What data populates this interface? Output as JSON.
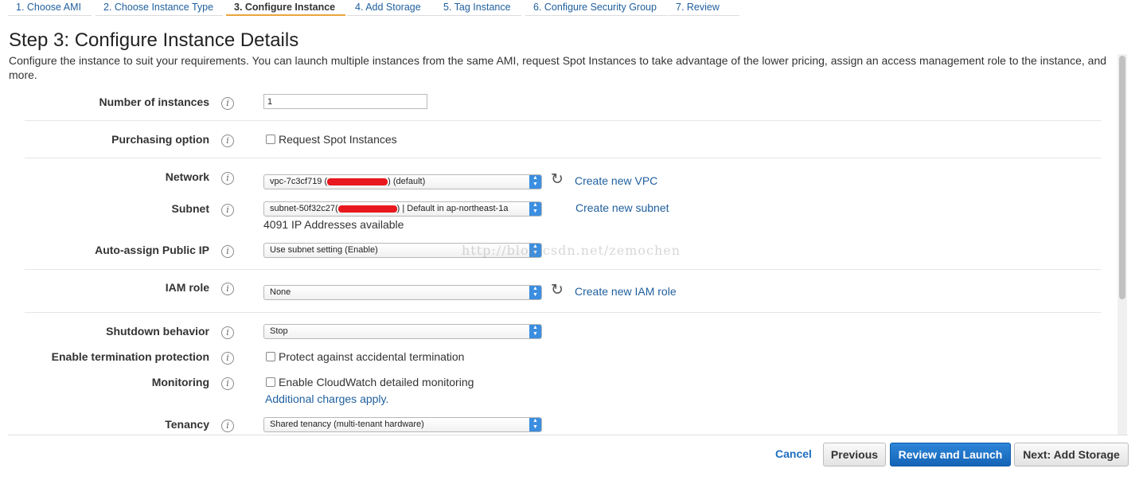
{
  "tabs": [
    {
      "label": "1. Choose AMI"
    },
    {
      "label": "2. Choose Instance Type"
    },
    {
      "label": "3. Configure Instance"
    },
    {
      "label": "4. Add Storage"
    },
    {
      "label": "5. Tag Instance"
    },
    {
      "label": "6. Configure Security Group"
    },
    {
      "label": "7. Review"
    }
  ],
  "page": {
    "title": "Step 3: Configure Instance Details",
    "description": "Configure the instance to suit your requirements. You can launch multiple instances from the same AMI, request Spot Instances to take advantage of the lower pricing, assign an access management role to the instance, and more."
  },
  "info_glyph": "i",
  "form": {
    "number_of_instances": {
      "label": "Number of instances",
      "value": "1"
    },
    "purchasing_option": {
      "label": "Purchasing option",
      "checkbox_label": "Request Spot Instances"
    },
    "network": {
      "label": "Network",
      "value_prefix": "vpc-7c3cf719 (",
      "value_suffix": ") (default)",
      "link": "Create new VPC"
    },
    "subnet": {
      "label": "Subnet",
      "value_prefix": "subnet-50f32c27(",
      "value_suffix": ") | Default in ap-northeast-1a",
      "link": "Create new subnet",
      "note": "4091 IP Addresses available"
    },
    "public_ip": {
      "label": "Auto-assign Public IP",
      "value": "Use subnet setting (Enable)"
    },
    "iam_role": {
      "label": "IAM role",
      "value": "None",
      "link": "Create new IAM role"
    },
    "shutdown": {
      "label": "Shutdown behavior",
      "value": "Stop"
    },
    "termination": {
      "label": "Enable termination protection",
      "checkbox_label": "Protect against accidental termination"
    },
    "monitoring": {
      "label": "Monitoring",
      "checkbox_label": "Enable CloudWatch detailed monitoring",
      "link": "Additional charges apply."
    },
    "tenancy": {
      "label": "Tenancy",
      "value": "Shared tenancy (multi-tenant hardware)"
    }
  },
  "watermark": "http://blog.csdn.net/zemochen",
  "footer": {
    "cancel": "Cancel",
    "previous": "Previous",
    "review_launch": "Review and Launch",
    "next": "Next: Add Storage"
  },
  "icons": {
    "refresh": "refresh-icon",
    "info": "info-icon",
    "select_arrow": "chevron-updown-icon"
  },
  "colors": {
    "link": "#1f5f9e",
    "primary_button": "#1f74c8",
    "active_tab_underline": "#e9a53a",
    "redaction": "#e8181e"
  }
}
